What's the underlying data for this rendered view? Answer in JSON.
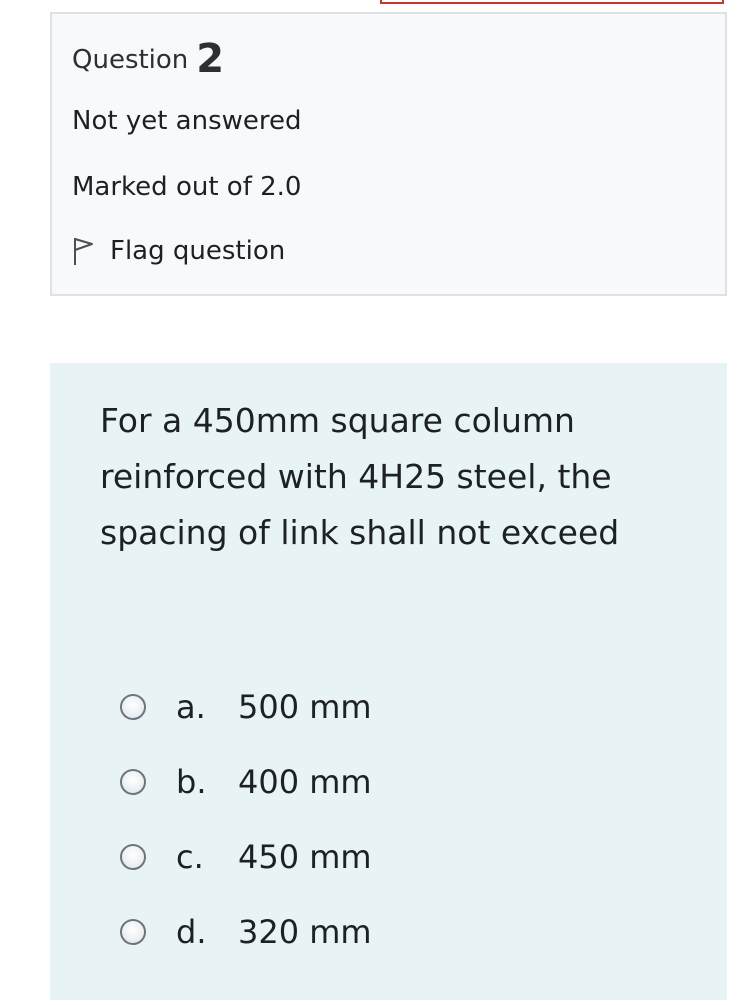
{
  "info": {
    "question_label": "Question",
    "question_number": "2",
    "state": "Not yet answered",
    "grade": "Marked out of 2.0",
    "flag_label": "Flag question"
  },
  "question": {
    "text": "For a 450mm square column reinforced with 4H25 steel, the spacing of link shall not exceed",
    "answers": [
      {
        "letter": "a.",
        "text": "500 mm"
      },
      {
        "letter": "b.",
        "text": "400 mm"
      },
      {
        "letter": "c.",
        "text": "450 mm"
      },
      {
        "letter": "d.",
        "text": "320 mm"
      }
    ]
  },
  "colors": {
    "info_background": "#f8f9fa",
    "info_border": "#dee2e6",
    "content_background": "#e7f3f5",
    "top_outline": "#c0392b"
  },
  "icons": {
    "flag": "flag-icon",
    "radio": "radio-unchecked-icon"
  }
}
